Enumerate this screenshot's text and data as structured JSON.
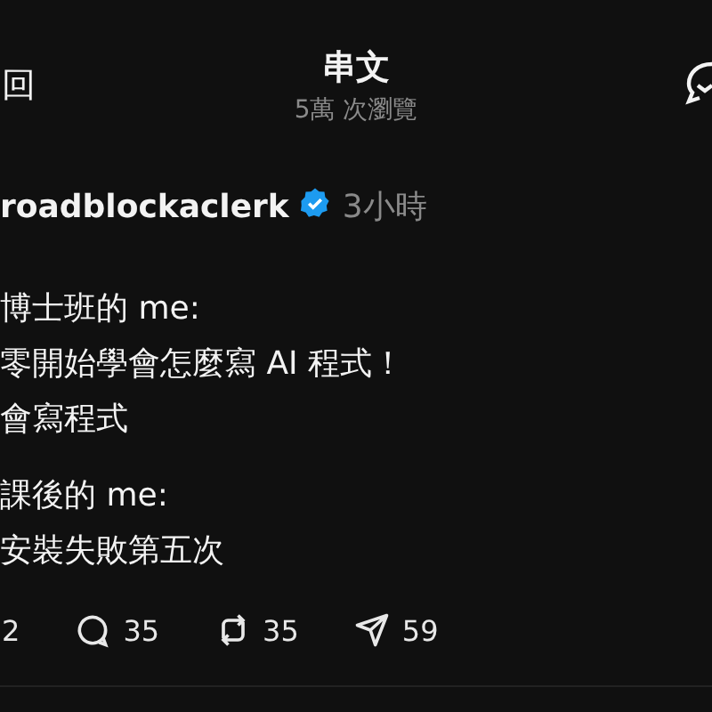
{
  "header": {
    "back_label": "回",
    "title": "串文",
    "subtitle": "5萬 次瀏覽"
  },
  "post": {
    "username": "roadblockaclerk",
    "verified": true,
    "time": "3小時",
    "paragraphs": [
      [
        "博士班的 me:",
        "零開始學會怎麼寫 AI 程式！",
        "會寫程式"
      ],
      [
        "課後的 me:",
        "安裝失敗第五次"
      ]
    ],
    "actions": [
      {
        "kind": "like",
        "count": "2"
      },
      {
        "kind": "reply",
        "count": "35"
      },
      {
        "kind": "repost",
        "count": "35"
      },
      {
        "kind": "share",
        "count": "59"
      }
    ]
  }
}
